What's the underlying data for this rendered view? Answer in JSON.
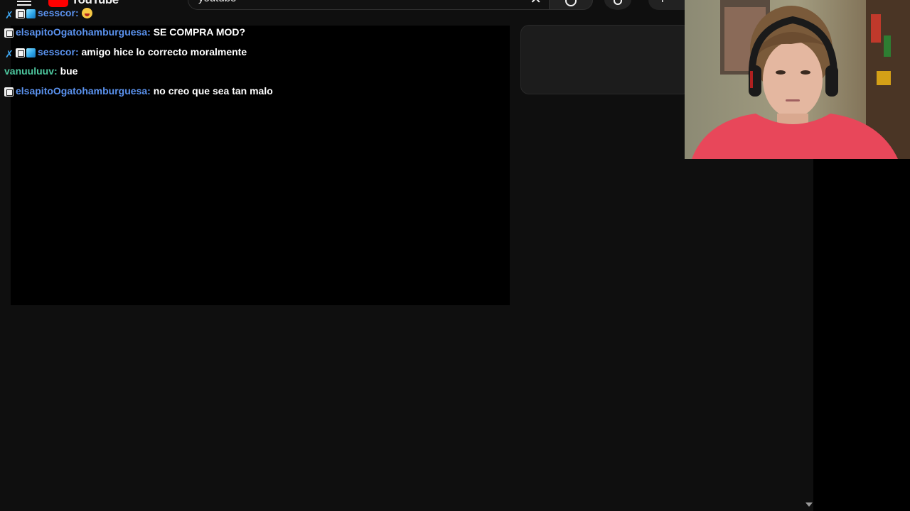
{
  "youtube": {
    "logo_text": "YouTube",
    "search_value": "youtube",
    "search_clear_icon": "close-icon",
    "search_icon": "search-icon",
    "mic_icon": "mic-icon",
    "create_icon": "plus-icon"
  },
  "chat": {
    "messages": [
      {
        "badges": [
          "mod-sword-icon",
          "qr-badge-icon",
          "cube-badge-icon"
        ],
        "username": "sesscor",
        "separator": ":",
        "text": "",
        "emote": "face-tongue-emoji",
        "user_color": "#5b93f0"
      },
      {
        "badges": [
          "qr-badge-icon"
        ],
        "username": "elsapitoOgatohamburguesa",
        "separator": ":",
        "text": "SE COMPRA MOD?",
        "user_color": "#5b93f0"
      },
      {
        "badges": [
          "mod-sword-icon",
          "qr-badge-icon",
          "cube-badge-icon"
        ],
        "username": "sesscor",
        "separator": ":",
        "text": "amigo hice lo correcto moralmente",
        "user_color": "#5b93f0"
      },
      {
        "badges": [],
        "username": "vanuuluuv",
        "separator": ":",
        "text": "bue",
        "user_color": "#4ec9a0"
      },
      {
        "badges": [
          "qr-badge-icon"
        ],
        "username": "elsapitoOgatohamburguesa",
        "separator": ":",
        "text": "no creo que sea tan malo",
        "user_color": "#5b93f0"
      }
    ]
  },
  "colors": {
    "background": "#0f0f0f",
    "chat_background": "#000000",
    "username_blue": "#5b93f0",
    "username_green": "#4ec9a0",
    "mod_badge": "#3fa9f5",
    "youtube_red": "#ff0000"
  },
  "webcam": {
    "description_icon": "webcam-feed"
  }
}
